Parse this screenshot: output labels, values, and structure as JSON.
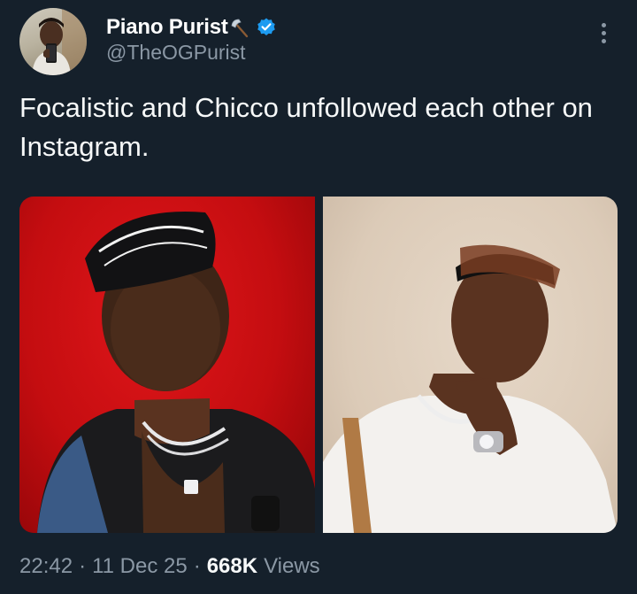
{
  "author": {
    "display_name": "Piano Purist",
    "handle": "@TheOGPurist",
    "badge_icon": "axe-icon",
    "verified_icon": "verified-badge-icon",
    "verified_color": "#1d9bf0"
  },
  "menu": {
    "icon": "more-options-icon"
  },
  "tweet": {
    "text": "Focalistic and Chicco unfollowed each other on Instagram."
  },
  "media": {
    "left_photo": {
      "description_icon": "photo-focalistic",
      "background": "#d11014"
    },
    "right_photo": {
      "description_icon": "photo-chicco",
      "background": "#ddcdbb"
    }
  },
  "meta": {
    "time": "22:42",
    "separator": "·",
    "date": "11 Dec 25",
    "views_count": "668K",
    "views_label": "Views"
  },
  "colors": {
    "background": "#15202b",
    "text_primary": "#f7f9f9",
    "text_secondary": "#8b98a5"
  }
}
